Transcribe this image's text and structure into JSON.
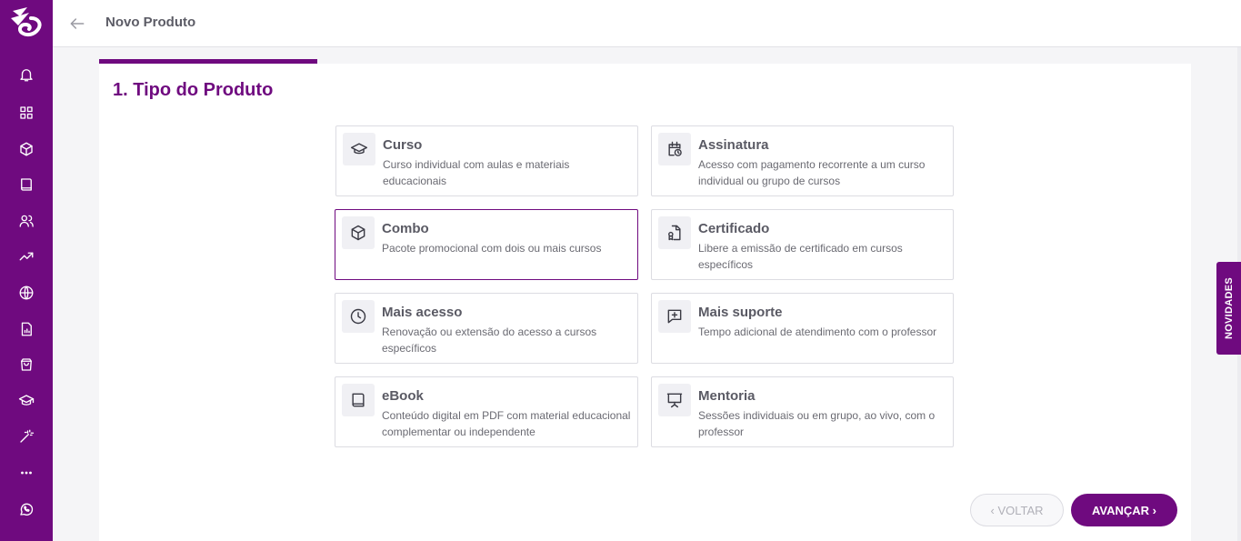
{
  "header": {
    "title": "Novo Produto"
  },
  "step": {
    "title": "1. Tipo do Produto",
    "progress_fraction": 0.2
  },
  "cards": [
    {
      "title": "Curso",
      "desc": "Curso individual com aulas e materiais educacionais",
      "icon": "graduation-cap-icon"
    },
    {
      "title": "Assinatura",
      "desc": "Acesso com pagamento recorrente a um curso individual ou grupo de cursos",
      "icon": "calendar-clock-icon"
    },
    {
      "title": "Combo",
      "desc": "Pacote promocional com dois ou mais cursos",
      "icon": "box-icon"
    },
    {
      "title": "Certificado",
      "desc": "Libere a emissão de certificado em cursos específicos",
      "icon": "certificate-icon"
    },
    {
      "title": "Mais acesso",
      "desc": "Renovação ou extensão do acesso a cursos específicos",
      "icon": "clock-icon"
    },
    {
      "title": "Mais suporte",
      "desc": "Tempo adicional de atendimento com o professor",
      "icon": "message-plus-icon"
    },
    {
      "title": "eBook",
      "desc": "Conteúdo digital em PDF com material educacional complementar ou independente",
      "icon": "book-icon"
    },
    {
      "title": "Mentoria",
      "desc": "Sessões individuais ou em grupo, ao vivo, com o professor",
      "icon": "presentation-icon"
    }
  ],
  "buttons": {
    "back": "VOLTAR",
    "next": "AVANÇAR"
  },
  "novidades": "NOVIDADES",
  "colors": {
    "brand": "#6f0a7f"
  }
}
